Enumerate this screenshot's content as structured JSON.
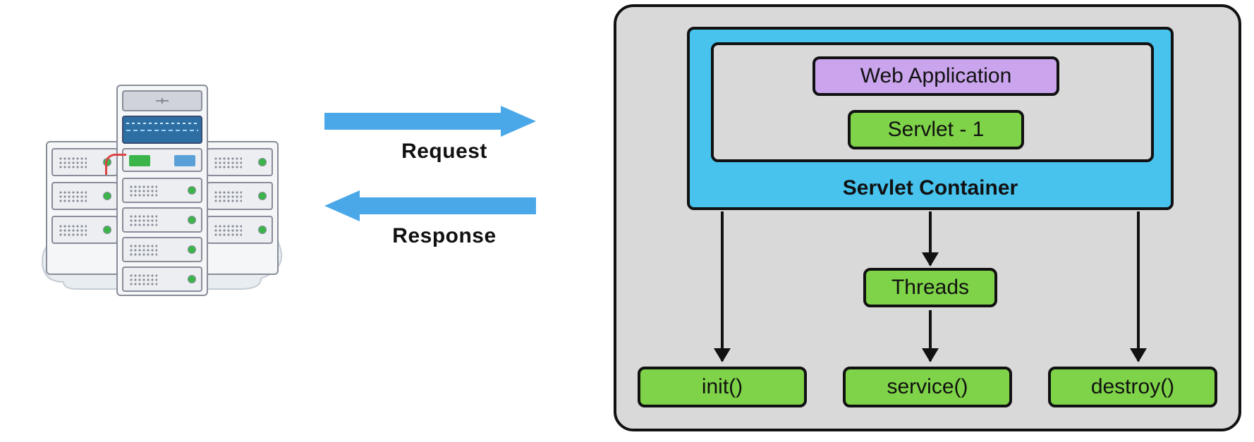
{
  "arrows": {
    "request_label": "Request",
    "response_label": "Response"
  },
  "container": {
    "servlet_container_label": "Servlet Container",
    "web_application_label": "Web Application",
    "servlet_label": "Servlet - 1",
    "threads_label": "Threads",
    "methods": {
      "init": "init()",
      "service": "service()",
      "destroy": "destroy()"
    }
  },
  "colors": {
    "arrow": "#4aa8e8",
    "container_bg": "#d9d9d9",
    "servlet_container_bg": "#47c3ee",
    "webapp_bg": "#caa4ec",
    "green": "#7ed348"
  }
}
